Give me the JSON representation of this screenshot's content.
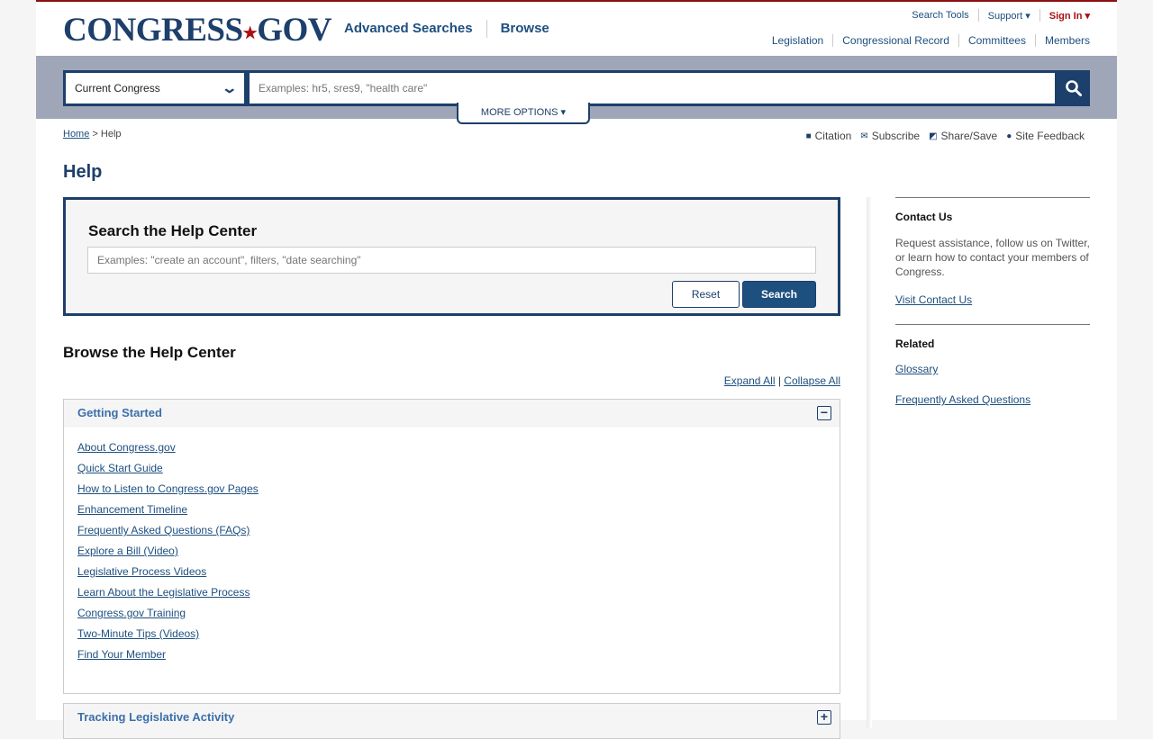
{
  "header": {
    "logo": "CONGRESS.GOV",
    "logo_left": "CONGRESS",
    "logo_star": "★",
    "logo_right": "GOV",
    "primary_nav": [
      "Advanced Searches",
      "Browse"
    ],
    "utility": [
      "Search Tools",
      "Support ▾",
      "Sign In ▾"
    ],
    "secondary_nav": [
      "Legislation",
      "Congressional Record",
      "Committees",
      "Members"
    ]
  },
  "search": {
    "scope_value": "Current Congress",
    "placeholder": "Examples: hr5, sres9, \"health care\"",
    "more_options": "MORE OPTIONS ▾"
  },
  "breadcrumb": {
    "home": "Home",
    "separator": " > ",
    "current": "Help"
  },
  "page_tools": [
    "Citation",
    "Subscribe",
    "Share/Save",
    "Site Feedback"
  ],
  "page_title": "Help",
  "help_search": {
    "title": "Search the Help Center",
    "placeholder": "Examples: \"create an account\", filters, \"date searching\"",
    "reset_label": "Reset",
    "search_label": "Search"
  },
  "browse": {
    "title": "Browse the Help Center",
    "expand_all": "Expand All",
    "divider": " | ",
    "collapse_all": "Collapse All",
    "sections": [
      {
        "title": "Getting Started",
        "toggle": "−",
        "links": [
          "About Congress.gov",
          "Quick Start Guide",
          "How to Listen to Congress.gov Pages",
          "Enhancement Timeline",
          "Frequently Asked Questions (FAQs)",
          "Explore a Bill (Video)",
          "Legislative Process Videos",
          "Learn About the Legislative Process",
          "Congress.gov Training",
          "Two-Minute Tips (Videos)",
          "Find Your Member"
        ]
      },
      {
        "title": "Tracking Legislative Activity",
        "toggle": "+"
      }
    ]
  },
  "sidebar": {
    "contact": {
      "title": "Contact Us",
      "text": "Request assistance, follow us on Twitter, or learn how to contact your members of Congress.",
      "link": "Visit Contact Us"
    },
    "related": {
      "title": "Related",
      "links": [
        "Glossary",
        "Frequently Asked Questions"
      ]
    }
  }
}
